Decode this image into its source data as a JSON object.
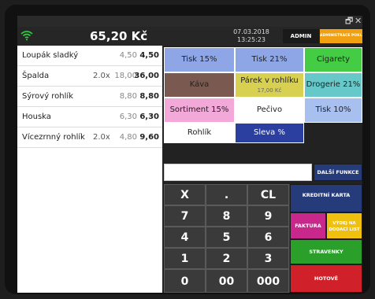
{
  "window": {
    "restore_glyph": "🗗",
    "close_glyph": "✕"
  },
  "status": {
    "total": "65,20 Kč",
    "date": "07.03.2018",
    "time": "13:25:23"
  },
  "header_buttons": {
    "admin": "ADMIN",
    "admin_registers": "ADMINISTRACE POKLADNY"
  },
  "receipt": {
    "items": [
      {
        "name": "Loupák sladký",
        "qty": "",
        "price": "4,50",
        "sum": "4,50"
      },
      {
        "name": "Špalda",
        "qty": "2.0x",
        "price": "18,00",
        "sum": "36,00"
      },
      {
        "name": "Sýrový rohlík",
        "qty": "",
        "price": "8,80",
        "sum": "8,80"
      },
      {
        "name": "Houska",
        "qty": "",
        "price": "6,30",
        "sum": "6,30"
      },
      {
        "name": "Vícezrnný rohlík",
        "qty": "2.0x",
        "price": "4,80",
        "sum": "9,60"
      }
    ]
  },
  "categories": [
    {
      "label": "Tisk 15%",
      "sub": "",
      "bg": "#8ea6e6"
    },
    {
      "label": "Tisk 21%",
      "sub": "",
      "bg": "#8ea6e6"
    },
    {
      "label": "Cigarety",
      "sub": "",
      "bg": "#44cc44"
    },
    {
      "label": "Káva",
      "sub": "",
      "bg": "#7a5a50"
    },
    {
      "label": "Párek v rohlíku",
      "sub": "17,00 Kč",
      "bg": "#d8d050"
    },
    {
      "label": "Drogerie 21%",
      "sub": "",
      "bg": "#66c8c8"
    },
    {
      "label": "Sortiment 15%",
      "sub": "",
      "bg": "#f2a8d8"
    },
    {
      "label": "Pečivo",
      "sub": "",
      "bg": "#ffffff"
    },
    {
      "label": "Tisk 10%",
      "sub": "",
      "bg": "#a8c0f0"
    },
    {
      "label": "Rohlík",
      "sub": "",
      "bg": "#ffffff"
    },
    {
      "label": "Sleva %",
      "sub": "",
      "bg": "#2b3fa0"
    }
  ],
  "functions": {
    "more": "DALŠÍ FUNKCE",
    "credit_card": "KREDITNÍ KARTA",
    "invoice": "FAKTURA",
    "delivery_note": "VÝDEJ NA DODACÍ LIST",
    "vouchers": "STRAVENKY",
    "cash": "HOTOVĚ"
  },
  "keypad": [
    "X",
    ".",
    "CL",
    "7",
    "8",
    "9",
    "4",
    "5",
    "6",
    "1",
    "2",
    "3",
    "0",
    "00",
    "000"
  ],
  "colors": {
    "accent_green": "#2ecc40",
    "admin_orange": "#f0a010",
    "func_blue": "#263b7a",
    "invoice_magenta": "#c8288c",
    "vouchers_green": "#2aa02a",
    "cash_red": "#d0202a"
  }
}
